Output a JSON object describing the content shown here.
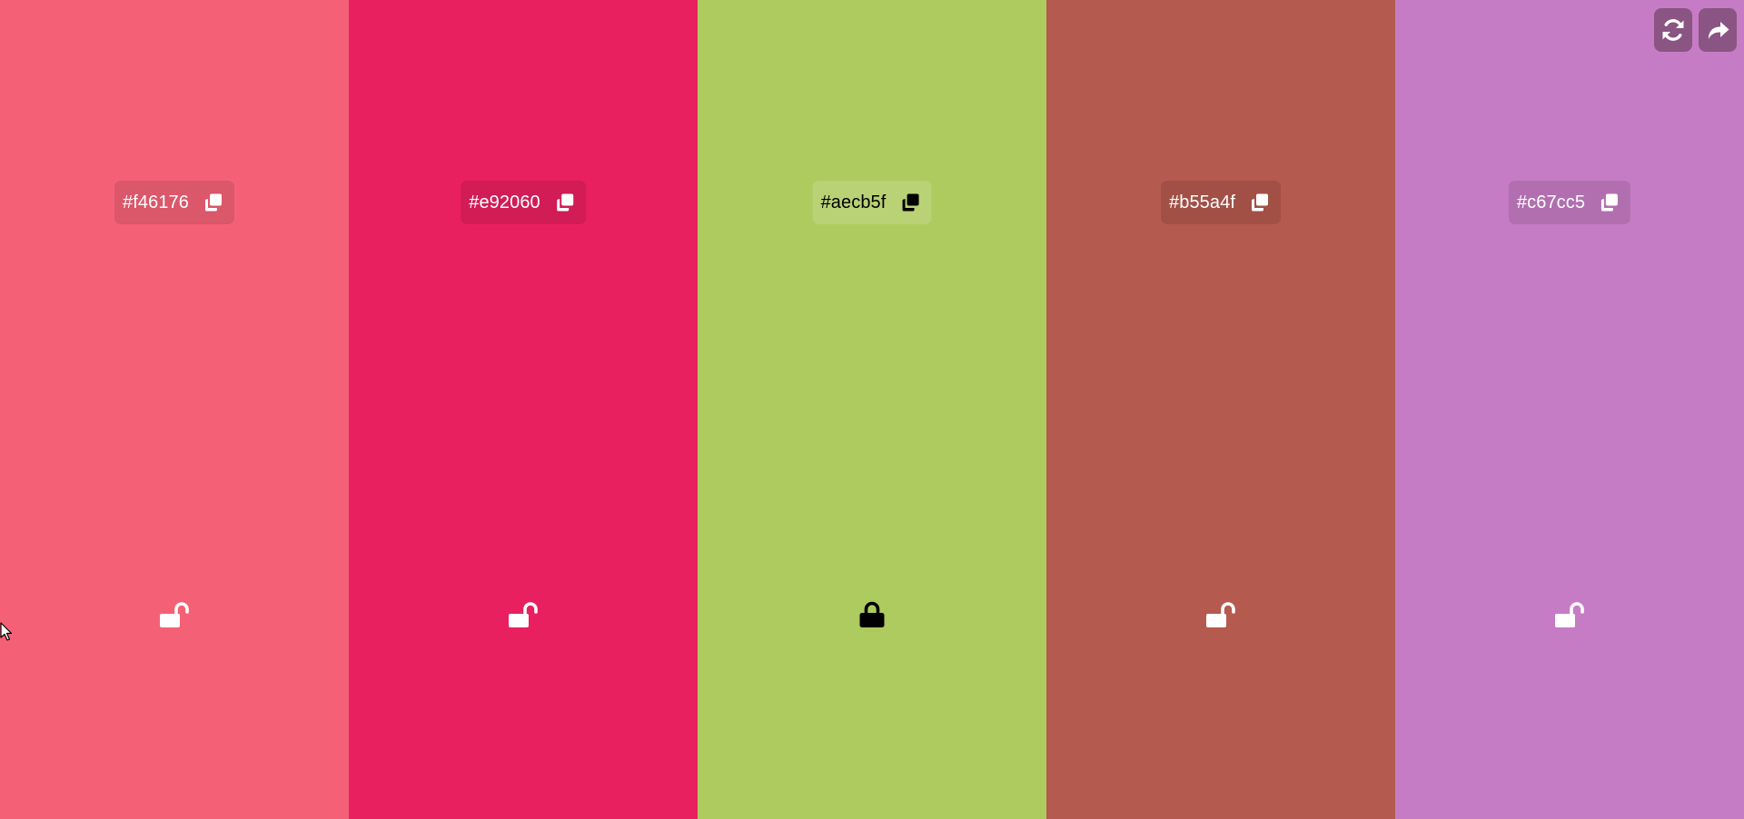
{
  "toolbar": {
    "buttons": [
      {
        "icon": "refresh-icon"
      },
      {
        "icon": "share-icon"
      }
    ],
    "button_color": "#8a5483"
  },
  "palette": {
    "colors": [
      {
        "hex": "#f46176",
        "background": "#f46176",
        "locked": false,
        "text_color": "#ffffff"
      },
      {
        "hex": "#e92060",
        "background": "#e92060",
        "locked": false,
        "text_color": "#ffffff"
      },
      {
        "hex": "#aecb5f",
        "background": "#aecb5f",
        "locked": true,
        "text_color": "#000000"
      },
      {
        "hex": "#b55a4f",
        "background": "#b55a4f",
        "locked": false,
        "text_color": "#ffffff"
      },
      {
        "hex": "#c67cc5",
        "background": "#c67cc5",
        "locked": false,
        "text_color": "#ffffff"
      }
    ]
  }
}
